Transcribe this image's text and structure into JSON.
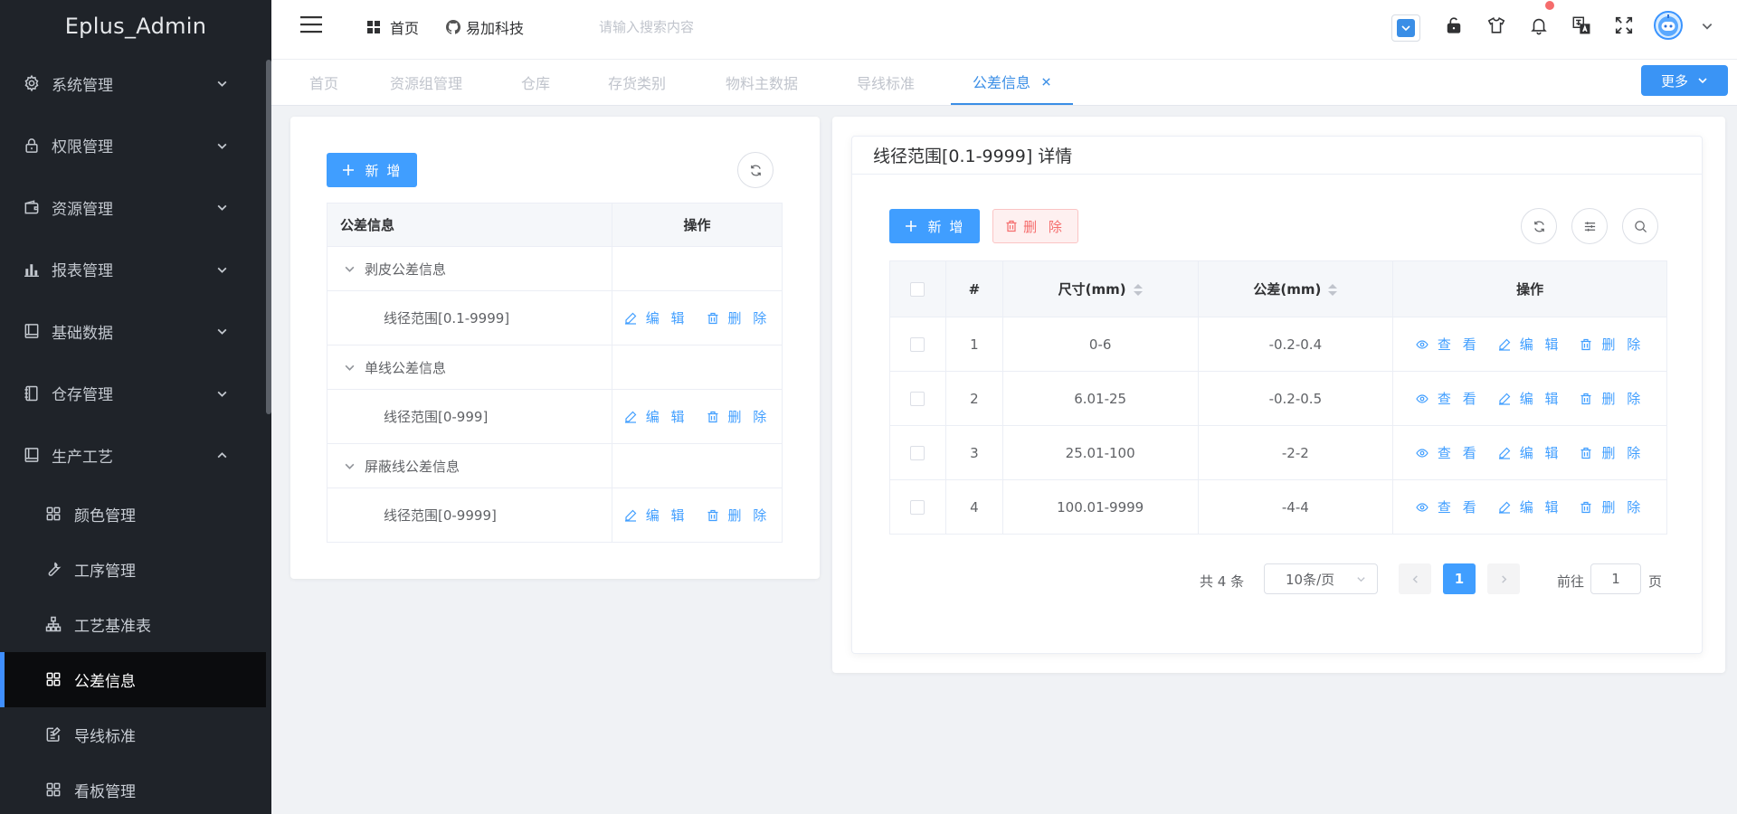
{
  "app": {
    "title": "Eplus_Admin"
  },
  "sidebar": {
    "items": [
      {
        "label": "系统管理",
        "icon": "gear-icon",
        "expanded": false
      },
      {
        "label": "权限管理",
        "icon": "lock-icon",
        "expanded": false
      },
      {
        "label": "资源管理",
        "icon": "wallet-icon",
        "expanded": false
      },
      {
        "label": "报表管理",
        "icon": "bar-chart-icon",
        "expanded": false
      },
      {
        "label": "基础数据",
        "icon": "book-icon",
        "expanded": false
      },
      {
        "label": "仓存管理",
        "icon": "notebook-icon",
        "expanded": false
      },
      {
        "label": "生产工艺",
        "icon": "book-icon",
        "expanded": true
      }
    ],
    "sub_items": [
      {
        "label": "颜色管理",
        "icon": "grid-icon"
      },
      {
        "label": "工序管理",
        "icon": "wrench-icon"
      },
      {
        "label": "工艺基准表",
        "icon": "org-chart-icon"
      },
      {
        "label": "公差信息",
        "icon": "grid-icon",
        "active": true
      },
      {
        "label": "导线标准",
        "icon": "edit-note-icon"
      },
      {
        "label": "看板管理",
        "icon": "grid-icon"
      }
    ]
  },
  "header": {
    "home_label": "首页",
    "company_label": "易加科技",
    "search_placeholder": "请输入搜索内容"
  },
  "tabs": [
    {
      "label": "首页"
    },
    {
      "label": "资源组管理"
    },
    {
      "label": "仓库"
    },
    {
      "label": "存货类别"
    },
    {
      "label": "物料主数据"
    },
    {
      "label": "导线标准"
    },
    {
      "label": "公差信息",
      "active": true
    }
  ],
  "more_label": "更多",
  "left_panel": {
    "add_label": "新 增",
    "columns": [
      "公差信息",
      "操作"
    ],
    "groups": [
      {
        "label": "剥皮公差信息",
        "children": [
          "线径范围[0.1-9999]"
        ]
      },
      {
        "label": "单线公差信息",
        "children": [
          "线径范围[0-999]"
        ]
      },
      {
        "label": "屏蔽线公差信息",
        "children": [
          "线径范围[0-9999]"
        ]
      }
    ],
    "edit_label": "编 辑",
    "delete_label": "删 除"
  },
  "detail": {
    "title": "线径范围[0.1-9999] 详情",
    "add_label": "新 增",
    "delete_label": "删 除",
    "columns": [
      "#",
      "尺寸(mm)",
      "公差(mm)",
      "操作"
    ],
    "rows": [
      {
        "no": "1",
        "size": "0-6",
        "tolerance": "-0.2-0.4"
      },
      {
        "no": "2",
        "size": "6.01-25",
        "tolerance": "-0.2-0.5"
      },
      {
        "no": "3",
        "size": "25.01-100",
        "tolerance": "-2-2"
      },
      {
        "no": "4",
        "size": "100.01-9999",
        "tolerance": "-4-4"
      }
    ],
    "view_label": "查 看",
    "edit_label": "编 辑",
    "remove_label": "删 除"
  },
  "pagination": {
    "total_text": "共 4 条",
    "page_size": "10条/页",
    "current_page": "1",
    "goto_label": "前往",
    "goto_value": "1",
    "page_unit": "页"
  },
  "colors": {
    "primary": "#409eff",
    "sidebar_bg": "#1f2329",
    "danger": "#f56c6c"
  }
}
